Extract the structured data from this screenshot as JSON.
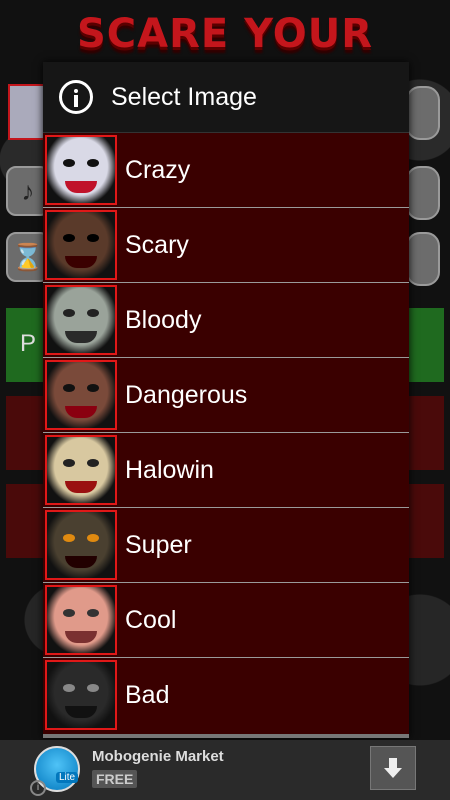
{
  "app": {
    "title": "SCARE YOUR FRIENDS",
    "bg_button_label": "P"
  },
  "dialog": {
    "title": "Select Image",
    "items": [
      {
        "label": "Crazy",
        "icon": "crazy-face-thumbnail"
      },
      {
        "label": "Scary",
        "icon": "scary-face-thumbnail"
      },
      {
        "label": "Bloody",
        "icon": "bloody-face-thumbnail"
      },
      {
        "label": "Dangerous",
        "icon": "dangerous-face-thumbnail"
      },
      {
        "label": "Halowin",
        "icon": "halowin-face-thumbnail"
      },
      {
        "label": "Super",
        "icon": "super-face-thumbnail"
      },
      {
        "label": "Cool",
        "icon": "cool-face-thumbnail"
      },
      {
        "label": "Bad",
        "icon": "bad-face-thumbnail"
      }
    ]
  },
  "ad": {
    "app_name": "Mobogenie Market",
    "badge": "FREE",
    "logo_tag": "Lite"
  },
  "colors": {
    "dialog_bg": "#3a0000",
    "thumbnail_border": "#e01818",
    "title_red": "#c4161c"
  }
}
